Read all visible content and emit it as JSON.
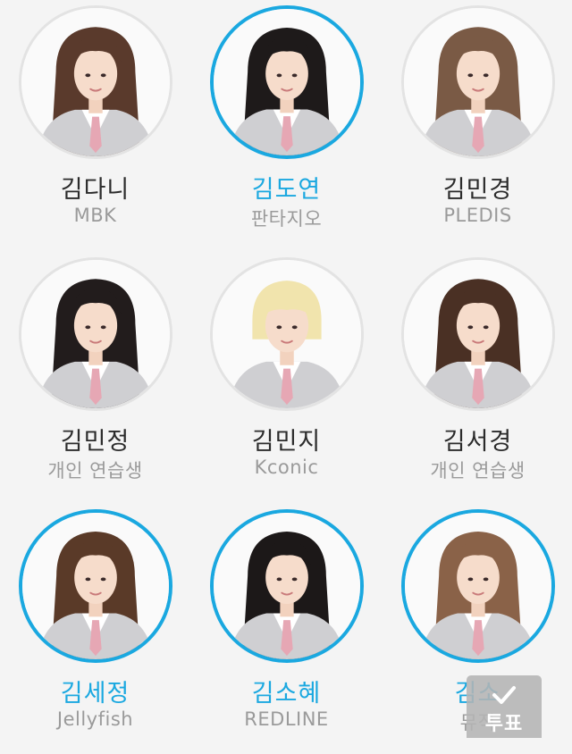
{
  "trainees": [
    {
      "name": "김다니",
      "agency": "MBK",
      "selected": false,
      "hair": "#5a3a2c"
    },
    {
      "name": "김도연",
      "agency": "판타지오",
      "selected": true,
      "hair": "#1e1a1a"
    },
    {
      "name": "김민경",
      "agency": "PLEDIS",
      "selected": false,
      "hair": "#7a5a45"
    },
    {
      "name": "김민정",
      "agency": "개인 연습생",
      "selected": false,
      "hair": "#221c1c"
    },
    {
      "name": "김민지",
      "agency": "Kconic",
      "selected": false,
      "hair": "#f1e4ad"
    },
    {
      "name": "김서경",
      "agency": "개인 연습생",
      "selected": false,
      "hair": "#4a3024"
    },
    {
      "name": "김세정",
      "agency": "Jellyfish",
      "selected": true,
      "hair": "#5a3a28"
    },
    {
      "name": "김소혜",
      "agency": "REDLINE",
      "selected": true,
      "hair": "#1c1818"
    },
    {
      "name": "김소",
      "agency": "뮤직",
      "selected": true,
      "hair": "#8a6248"
    }
  ],
  "vote_button": {
    "label": "투표",
    "icon": "check-icon"
  },
  "colors": {
    "accent": "#1aa8e0",
    "name_text": "#2b2b2b",
    "agency_text": "#9a9a9a",
    "background": "#f4f4f4"
  }
}
